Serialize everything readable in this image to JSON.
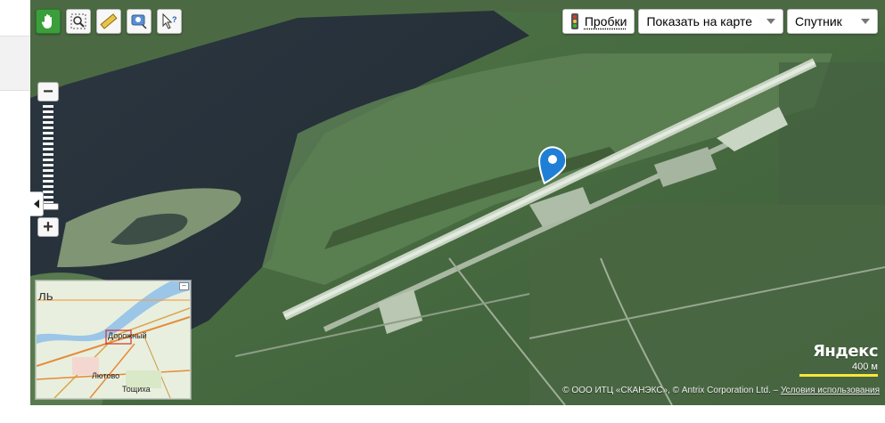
{
  "toolbar": {
    "tools": [
      {
        "name": "hand-icon",
        "active": true
      },
      {
        "name": "zoom-area-icon",
        "active": false
      },
      {
        "name": "ruler-icon",
        "active": false
      },
      {
        "name": "pin-add-icon",
        "active": false
      },
      {
        "name": "info-cursor-icon",
        "active": false
      }
    ]
  },
  "topbar": {
    "traffic_label": "Пробки",
    "show_on_map_label": "Показать на карте",
    "layer_label": "Спутник"
  },
  "zoom": {
    "plus": "+",
    "minus": "−",
    "level_fraction": 0.95
  },
  "minimap": {
    "labels": {
      "city_fragment": "ль",
      "road": "Дорожный",
      "village1": "Лютово",
      "village2": "Тощиха"
    },
    "close": "–"
  },
  "branding": {
    "logo": "Яндекс",
    "scale": "400 м"
  },
  "copyright": {
    "text": "© ООО ИТЦ «СКАНЭКС», © Antrix Corporation Ltd. – ",
    "terms": "Условия использования"
  },
  "colors": {
    "accent_green": "#3b9e3b",
    "pin_blue": "#1f7fd6",
    "scale_yellow": "#f7e63a"
  }
}
